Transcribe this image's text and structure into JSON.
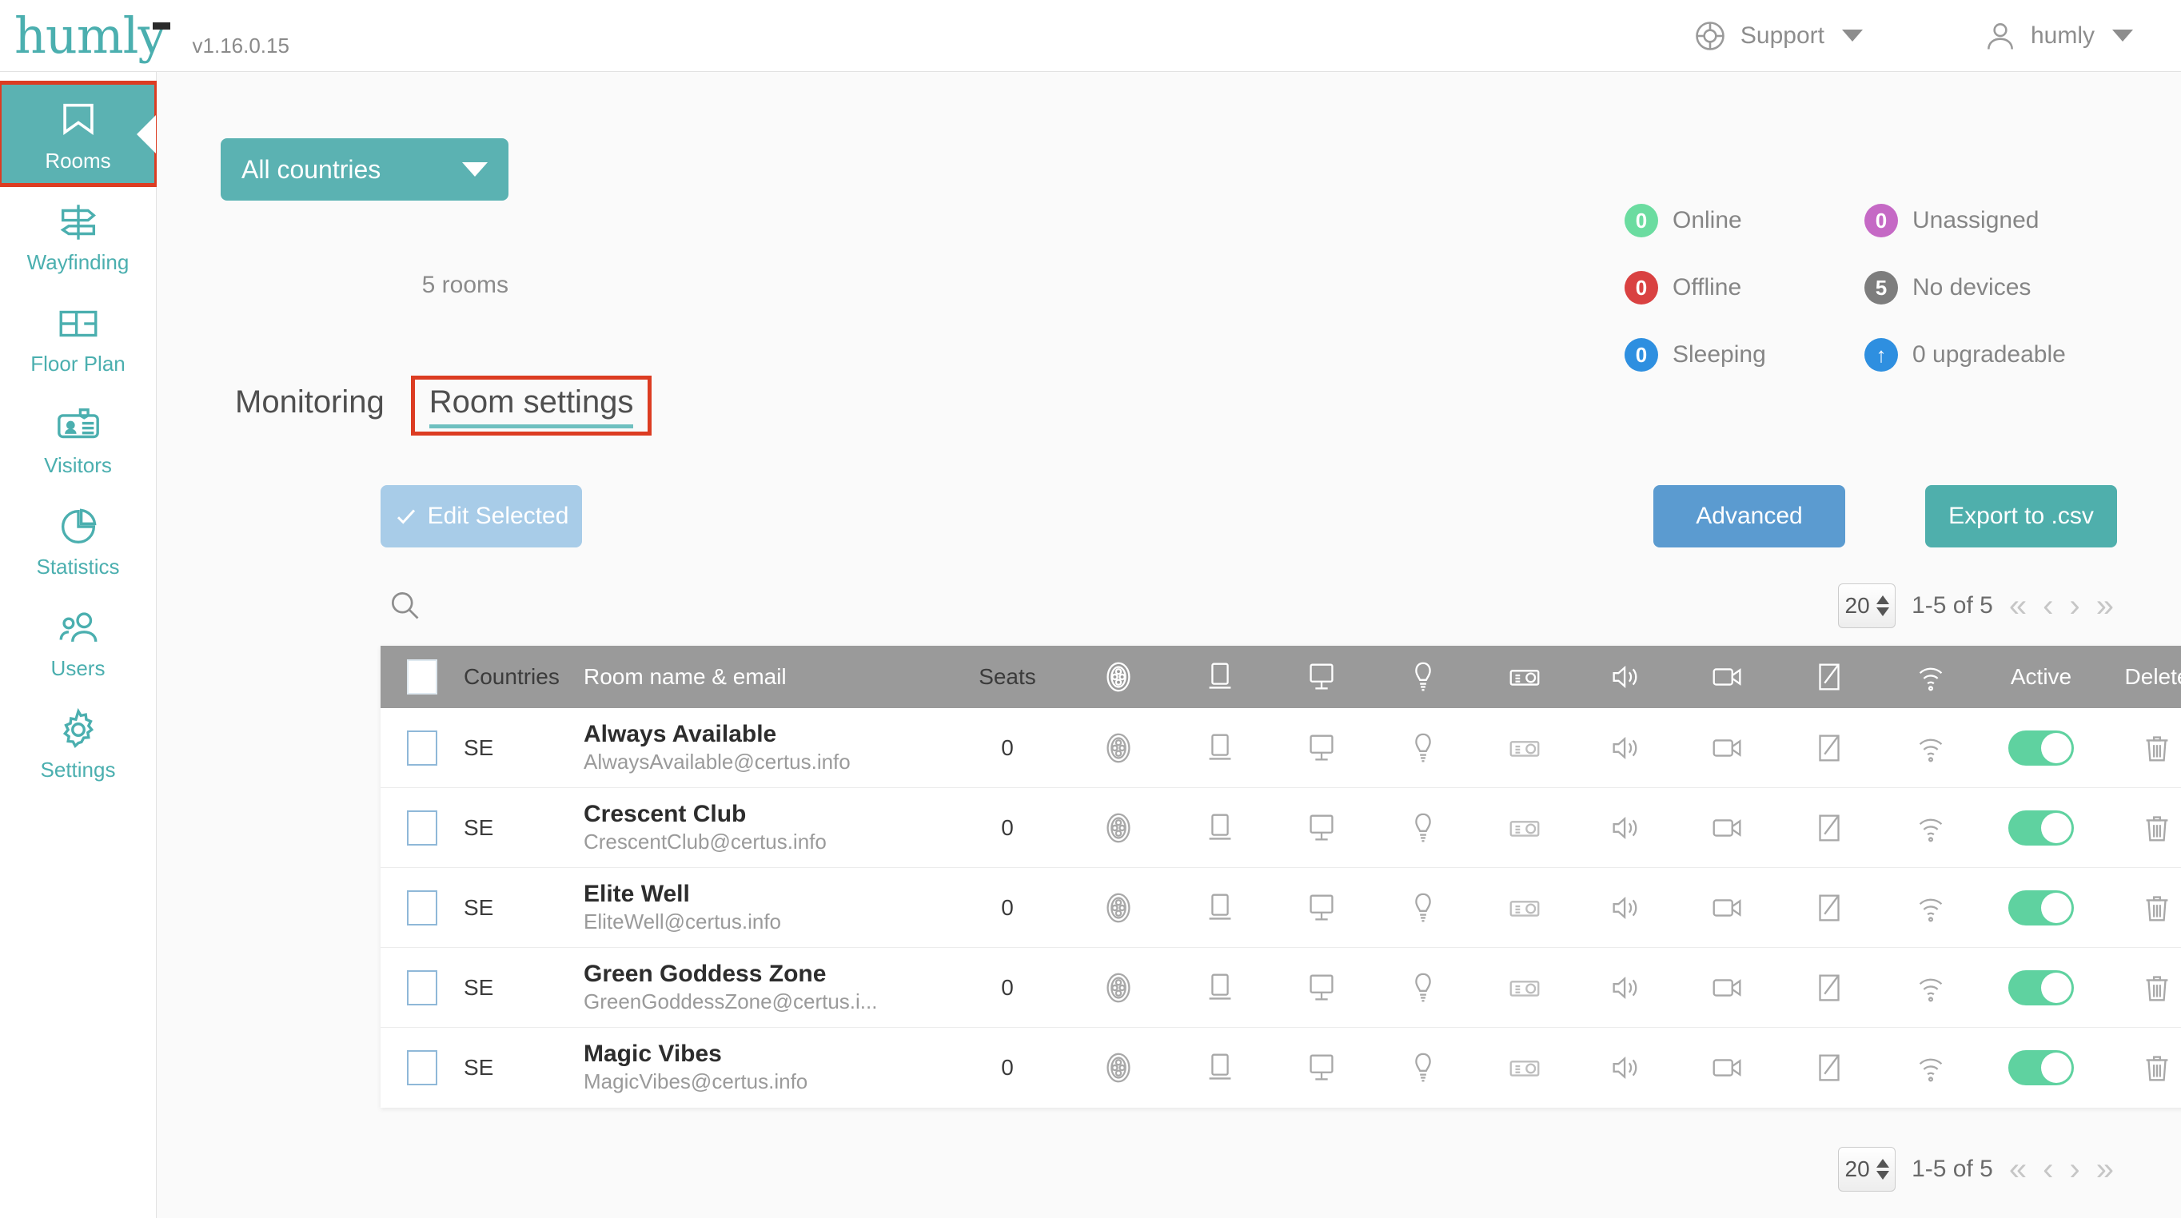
{
  "header": {
    "logo_text": "humly",
    "version": "v1.16.0.15",
    "support_label": "Support",
    "account_label": "humly"
  },
  "sidebar": {
    "items": [
      {
        "label": "Rooms",
        "icon": "bookmark-icon",
        "active": true
      },
      {
        "label": "Wayfinding",
        "icon": "signpost-icon",
        "active": false
      },
      {
        "label": "Floor Plan",
        "icon": "floorplan-icon",
        "active": false
      },
      {
        "label": "Visitors",
        "icon": "badge-icon",
        "active": false
      },
      {
        "label": "Statistics",
        "icon": "piechart-icon",
        "active": false
      },
      {
        "label": "Users",
        "icon": "people-icon",
        "active": false
      },
      {
        "label": "Settings",
        "icon": "gear-icon",
        "active": false
      }
    ]
  },
  "filters": {
    "country_selected": "All countries",
    "rooms_count_text": "5 rooms"
  },
  "status_legend": [
    {
      "count": "0",
      "label": "Online",
      "color": "#6BDCA0"
    },
    {
      "count": "0",
      "label": "Unassigned",
      "color": "#C569C5"
    },
    {
      "count": "0",
      "label": "Offline",
      "color": "#D94141"
    },
    {
      "count": "5",
      "label": "No devices",
      "color": "#7D7D7D"
    },
    {
      "count": "0",
      "label": "Sleeping",
      "color": "#2E8FE0"
    },
    {
      "count": "↑",
      "label": "0 upgradeable",
      "color": "#2E8FE0"
    }
  ],
  "tabs": [
    {
      "label": "Monitoring",
      "active": false
    },
    {
      "label": "Room settings",
      "active": true
    }
  ],
  "toolbar": {
    "edit_selected_label": "Edit Selected",
    "advanced_label": "Advanced",
    "export_label": "Export to .csv"
  },
  "pagination": {
    "page_size": "20",
    "range_text": "1-5 of 5",
    "first_label": "«",
    "prev_label": "‹",
    "next_label": "›",
    "last_label": "»"
  },
  "table": {
    "columns": [
      {
        "key": "check",
        "label": "",
        "icon": "checkbox-icon"
      },
      {
        "key": "country",
        "label": "Countries",
        "icon": ""
      },
      {
        "key": "name",
        "label": "Room name & email",
        "icon": ""
      },
      {
        "key": "seats",
        "label": "Seats",
        "icon": ""
      },
      {
        "key": "wheel",
        "label": "",
        "icon": "wheel-icon"
      },
      {
        "key": "laptop",
        "label": "",
        "icon": "laptop-icon"
      },
      {
        "key": "monitor",
        "label": "",
        "icon": "monitor-icon"
      },
      {
        "key": "light",
        "label": "",
        "icon": "lightbulb-icon"
      },
      {
        "key": "camera",
        "label": "",
        "icon": "camera-icon"
      },
      {
        "key": "speaker",
        "label": "",
        "icon": "speaker-icon"
      },
      {
        "key": "video",
        "label": "",
        "icon": "videocam-icon"
      },
      {
        "key": "board",
        "label": "",
        "icon": "whiteboard-icon"
      },
      {
        "key": "wifi",
        "label": "",
        "icon": "wifi-icon"
      },
      {
        "key": "active",
        "label": "Active",
        "icon": ""
      },
      {
        "key": "delete",
        "label": "Delete",
        "icon": ""
      }
    ],
    "rows": [
      {
        "country": "SE",
        "name": "Always Available",
        "email": "AlwaysAvailable@certus.info",
        "seats": "0",
        "active": true
      },
      {
        "country": "SE",
        "name": "Crescent Club",
        "email": "CrescentClub@certus.info",
        "seats": "0",
        "active": true
      },
      {
        "country": "SE",
        "name": "Elite Well",
        "email": "EliteWell@certus.info",
        "seats": "0",
        "active": true
      },
      {
        "country": "SE",
        "name": "Green Goddess Zone",
        "email": "GreenGoddessZone@certus.i...",
        "seats": "0",
        "active": true
      },
      {
        "country": "SE",
        "name": "Magic Vibes",
        "email": "MagicVibes@certus.info",
        "seats": "0",
        "active": true
      }
    ]
  },
  "colors": {
    "brand_teal": "#5BB2B2",
    "annotation_red": "#DC3C22",
    "blue_button": "#5B9BD0",
    "toggle_green": "#5FD2A0",
    "header_gray": "#9a9a9a"
  }
}
